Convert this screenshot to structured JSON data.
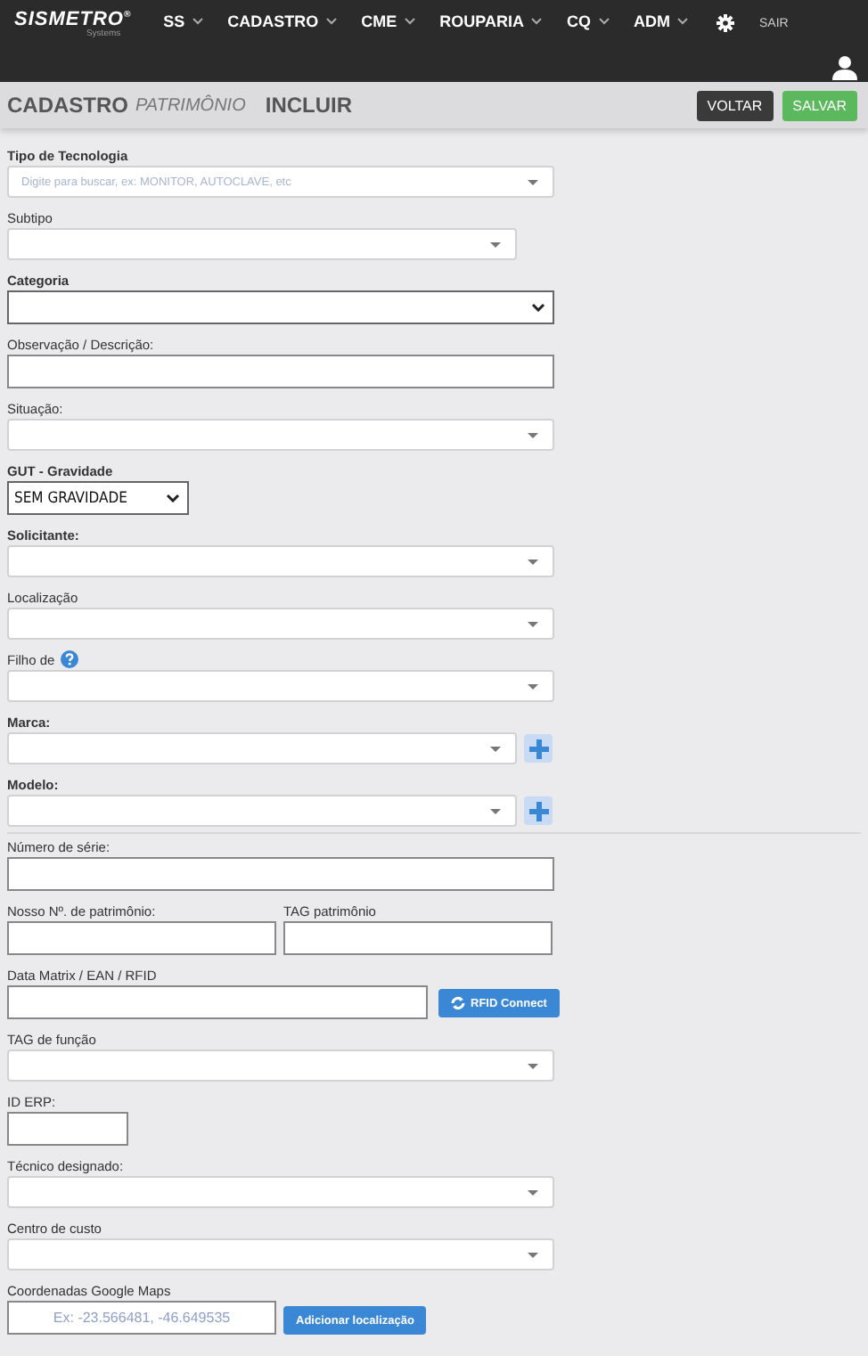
{
  "logo": {
    "name": "SISMETRO",
    "mark": "®",
    "tagline": "Systems"
  },
  "nav": [
    {
      "label": "SS"
    },
    {
      "label": "CADASTRO"
    },
    {
      "label": "CME"
    },
    {
      "label": "ROUPARIA"
    },
    {
      "label": "CQ"
    },
    {
      "label": "ADM"
    }
  ],
  "logout": "SAIR",
  "title": {
    "main": "CADASTRO",
    "sub": "PATRIMÔNIO",
    "action": "INCLUIR"
  },
  "buttons": [
    {
      "label": "VOLTAR",
      "kind": "dark"
    },
    {
      "label": "SALVAR",
      "kind": "success"
    }
  ],
  "rows": [
    {
      "fields": [
        {
          "label": "Tipo de Tecnologia",
          "bold": true,
          "kind": "search",
          "placeholder": "Digite para buscar, ex: MONITOR, AUTOCLAVE, etc"
        }
      ]
    },
    {
      "fields": [
        {
          "label": "Subtipo",
          "bold": false,
          "kind": "search"
        }
      ]
    },
    {
      "fields": [
        {
          "label": "Categoria",
          "bold": true,
          "kind": "select"
        }
      ]
    },
    {
      "fields": [
        {
          "label": "Observação / Descrição:",
          "bold": false,
          "kind": "text"
        }
      ]
    },
    {
      "fields": [
        {
          "label": "Situação:",
          "bold": false,
          "kind": "search"
        }
      ]
    },
    {
      "fields": [
        {
          "label": "GUT - Gravidade",
          "bold": true,
          "kind": "select",
          "value": "SEM GRAVIDADE"
        }
      ]
    },
    {
      "fields": [
        {
          "label": "Solicitante:",
          "bold": true,
          "kind": "search"
        }
      ]
    },
    {
      "fields": [
        {
          "label": "Localização",
          "bold": false,
          "kind": "search"
        }
      ]
    },
    {
      "fields": [
        {
          "label": "Filho de",
          "bold": false,
          "kind": "search",
          "help": true
        }
      ]
    },
    {
      "fields": [
        {
          "label": "Marca:",
          "bold": true,
          "kind": "search",
          "add": true
        }
      ]
    },
    {
      "fields": [
        {
          "label": "Modelo:",
          "bold": true,
          "kind": "search",
          "add": true
        }
      ]
    },
    {
      "fields": [
        {
          "label": "Número de série:",
          "bold": false,
          "kind": "text"
        }
      ]
    },
    {
      "fields": [
        {
          "label": "Nosso Nº. de patrimônio:",
          "bold": false,
          "kind": "text"
        },
        {
          "label": "TAG patrimônio",
          "bold": false,
          "kind": "text"
        }
      ]
    },
    {
      "fields": [
        {
          "label": "Data Matrix / EAN / RFID",
          "bold": false,
          "kind": "text"
        }
      ],
      "button": {
        "label": "RFID Connect",
        "icon": true
      }
    },
    {
      "fields": [
        {
          "label": "TAG de função",
          "bold": false,
          "kind": "search"
        }
      ]
    },
    {
      "fields": [
        {
          "label": "ID ERP:",
          "bold": false,
          "kind": "text"
        }
      ]
    },
    {
      "fields": [
        {
          "label": "Técnico designado:",
          "bold": false,
          "kind": "search"
        }
      ]
    },
    {
      "fields": [
        {
          "label": "Centro de custo",
          "bold": false,
          "kind": "search"
        }
      ]
    },
    {
      "fields": [
        {
          "label": "Coordenadas Google Maps",
          "bold": false,
          "kind": "text",
          "placeholder": "Ex: -23.566481, -46.649535"
        }
      ],
      "button": {
        "label": "Adicionar localização",
        "icon": false
      }
    }
  ]
}
